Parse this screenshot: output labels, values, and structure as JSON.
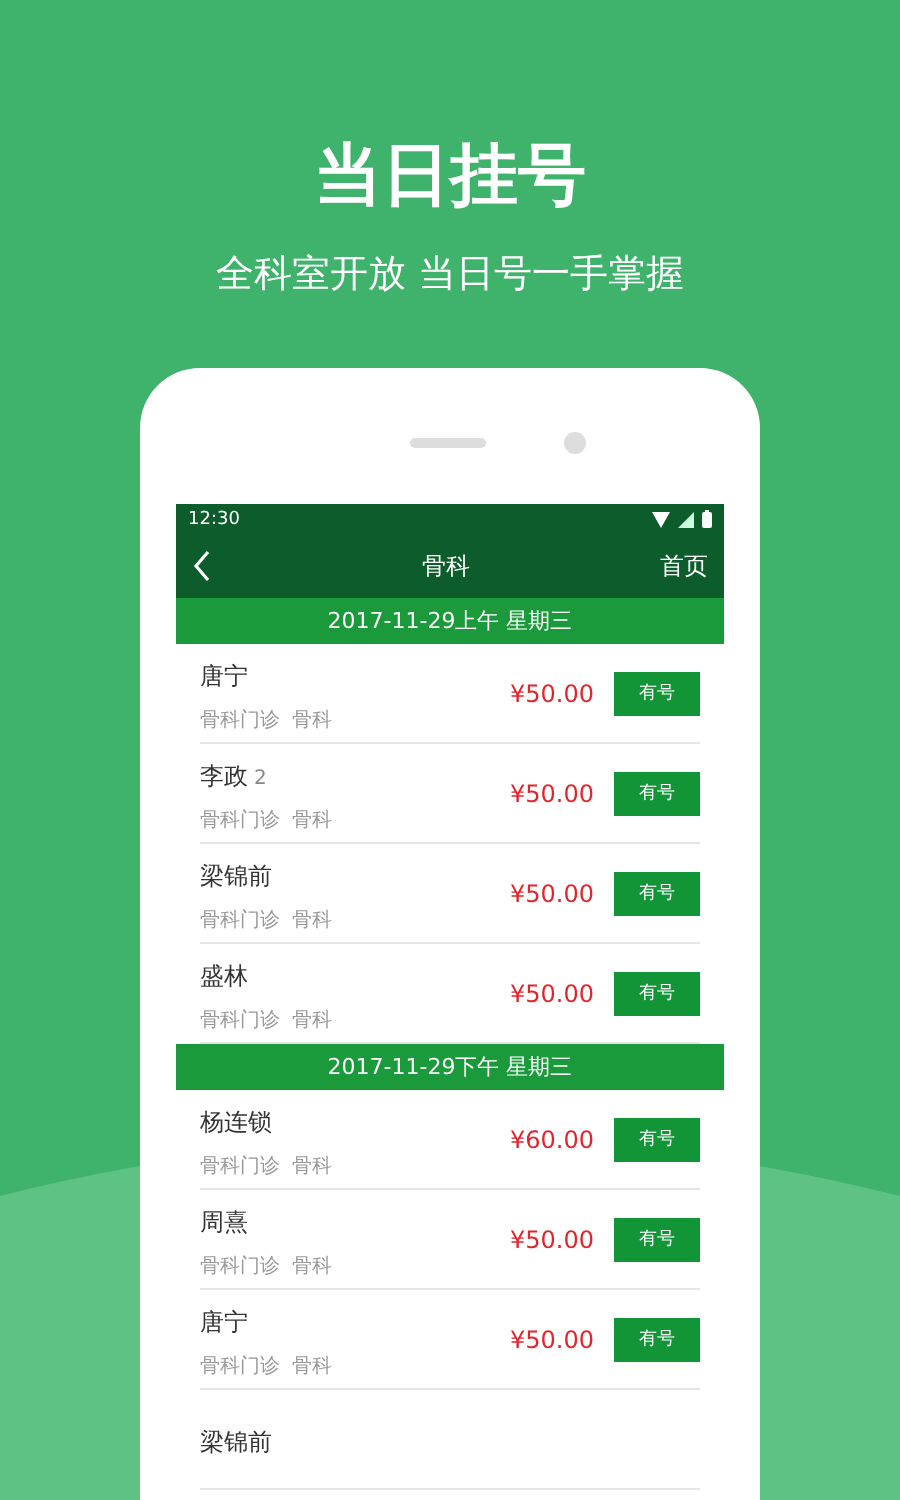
{
  "hero": {
    "title": "当日挂号",
    "subtitle": "全科室开放  当日号一手掌握"
  },
  "status_bar": {
    "time": "12:30"
  },
  "app_bar": {
    "title": "骨科",
    "action": "首页"
  },
  "sections": [
    {
      "date": "2017-11-29上午 星期三",
      "rows": [
        {
          "name": "唐宁",
          "sub": [
            "骨科门诊",
            "骨科"
          ],
          "price": "¥50.00",
          "button": "有号"
        },
        {
          "name": "李政",
          "badge": "2",
          "sub": [
            "骨科门诊",
            "骨科"
          ],
          "price": "¥50.00",
          "button": "有号"
        },
        {
          "name": "梁锦前",
          "sub": [
            "骨科门诊",
            "骨科"
          ],
          "price": "¥50.00",
          "button": "有号"
        },
        {
          "name": "盛林",
          "sub": [
            "骨科门诊",
            "骨科"
          ],
          "price": "¥50.00",
          "button": "有号"
        }
      ]
    },
    {
      "date": "2017-11-29下午 星期三",
      "rows": [
        {
          "name": "杨连锁",
          "sub": [
            "骨科门诊",
            "骨科"
          ],
          "price": "¥60.00",
          "button": "有号"
        },
        {
          "name": "周熹",
          "sub": [
            "骨科门诊",
            "骨科"
          ],
          "price": "¥50.00",
          "button": "有号"
        },
        {
          "name": "唐宁",
          "sub": [
            "骨科门诊",
            "骨科"
          ],
          "price": "¥50.00",
          "button": "有号"
        },
        {
          "name": "梁锦前"
        }
      ]
    }
  ]
}
